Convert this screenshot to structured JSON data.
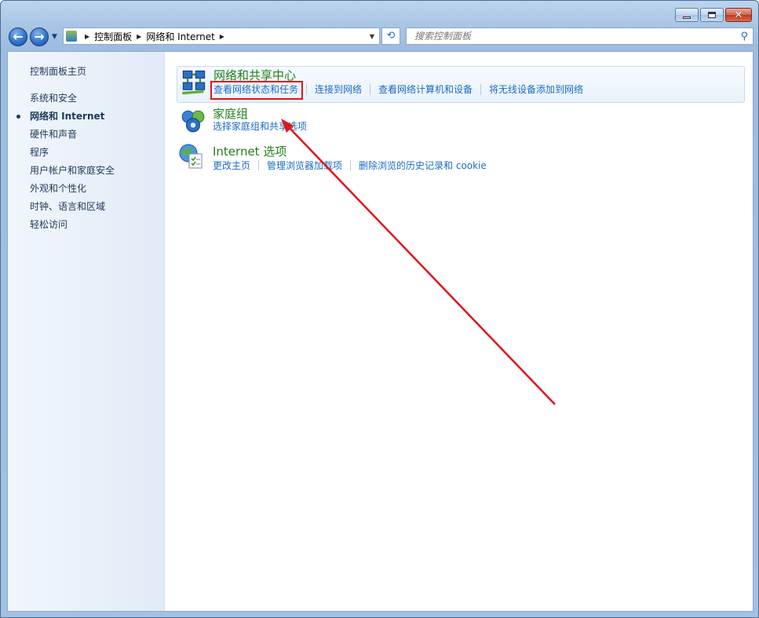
{
  "window": {
    "caption_buttons": {
      "minimize": "minimize-icon",
      "maximize": "maximize-icon",
      "close": "✕"
    }
  },
  "nav": {
    "back_glyph": "←",
    "forward_glyph": "→",
    "breadcrumbs": [
      "控制面板",
      "网络和 Internet"
    ],
    "refresh_glyph": "⟲",
    "search_placeholder": "搜索控制面板",
    "search_glyph": "⚲"
  },
  "sidebar": {
    "home": "控制面板主页",
    "items": [
      {
        "label": "系统和安全",
        "active": false
      },
      {
        "label": "网络和 Internet",
        "active": true
      },
      {
        "label": "硬件和声音",
        "active": false
      },
      {
        "label": "程序",
        "active": false
      },
      {
        "label": "用户帐户和家庭安全",
        "active": false
      },
      {
        "label": "外观和个性化",
        "active": false
      },
      {
        "label": "时钟、语言和区域",
        "active": false
      },
      {
        "label": "轻松访问",
        "active": false
      }
    ]
  },
  "categories": [
    {
      "title": "网络和共享中心",
      "icon": "network-sharing-center-icon",
      "links": [
        "查看网络状态和任务",
        "连接到网络",
        "查看网络计算机和设备",
        "将无线设备添加到网络"
      ]
    },
    {
      "title": "家庭组",
      "icon": "homegroup-icon",
      "links": [
        "选择家庭组和共享选项"
      ]
    },
    {
      "title": "Internet 选项",
      "icon": "internet-options-icon",
      "links": [
        "更改主页",
        "管理浏览器加载项",
        "删除浏览的历史记录和 cookie"
      ]
    }
  ],
  "annotation": {
    "color": "#e3141b"
  },
  "colors": {
    "title_green": "#1f7f18",
    "link_blue": "#1b6cc1",
    "frame_blue": "#a9c6e5"
  }
}
